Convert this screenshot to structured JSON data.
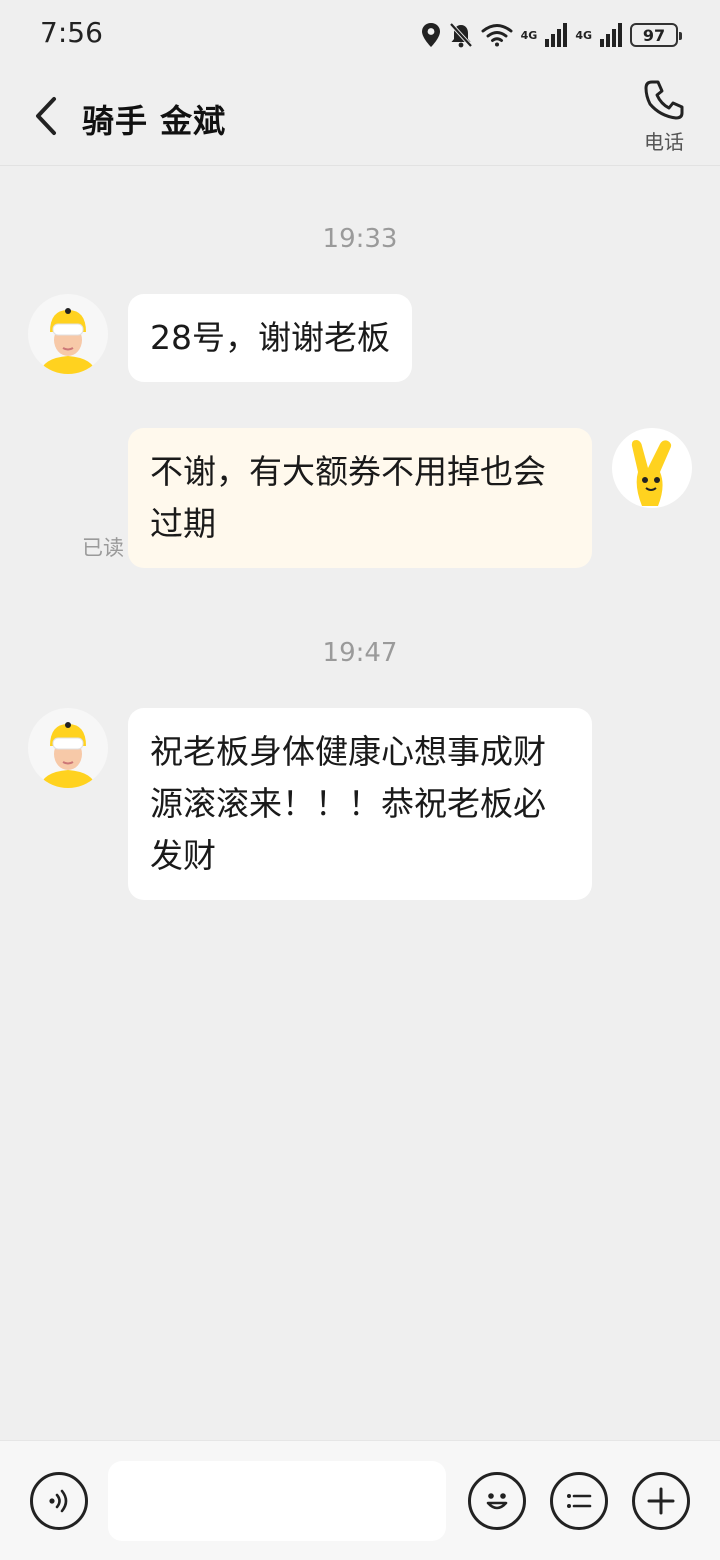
{
  "status_bar": {
    "time": "7:56",
    "battery": "97",
    "network_1": "4G",
    "network_2": "4G"
  },
  "header": {
    "title": "骑手 金斌",
    "phone_label": "电话"
  },
  "messages": [
    {
      "timestamp": "19:33"
    },
    {
      "sender": "rider",
      "text": "28号，谢谢老板"
    },
    {
      "sender": "me",
      "text": "不谢，有大额券不用掉也会过期",
      "read_status": "已读"
    },
    {
      "timestamp": "19:47"
    },
    {
      "sender": "rider",
      "text": "祝老板身体健康心想事成财源滚滚来！！！恭祝老板必发财"
    }
  ],
  "input": {
    "placeholder": ""
  },
  "colors": {
    "background": "#efefef",
    "bubble_received": "#ffffff",
    "bubble_sent": "#fff9ed",
    "avatar_accent": "#ffd21f"
  }
}
